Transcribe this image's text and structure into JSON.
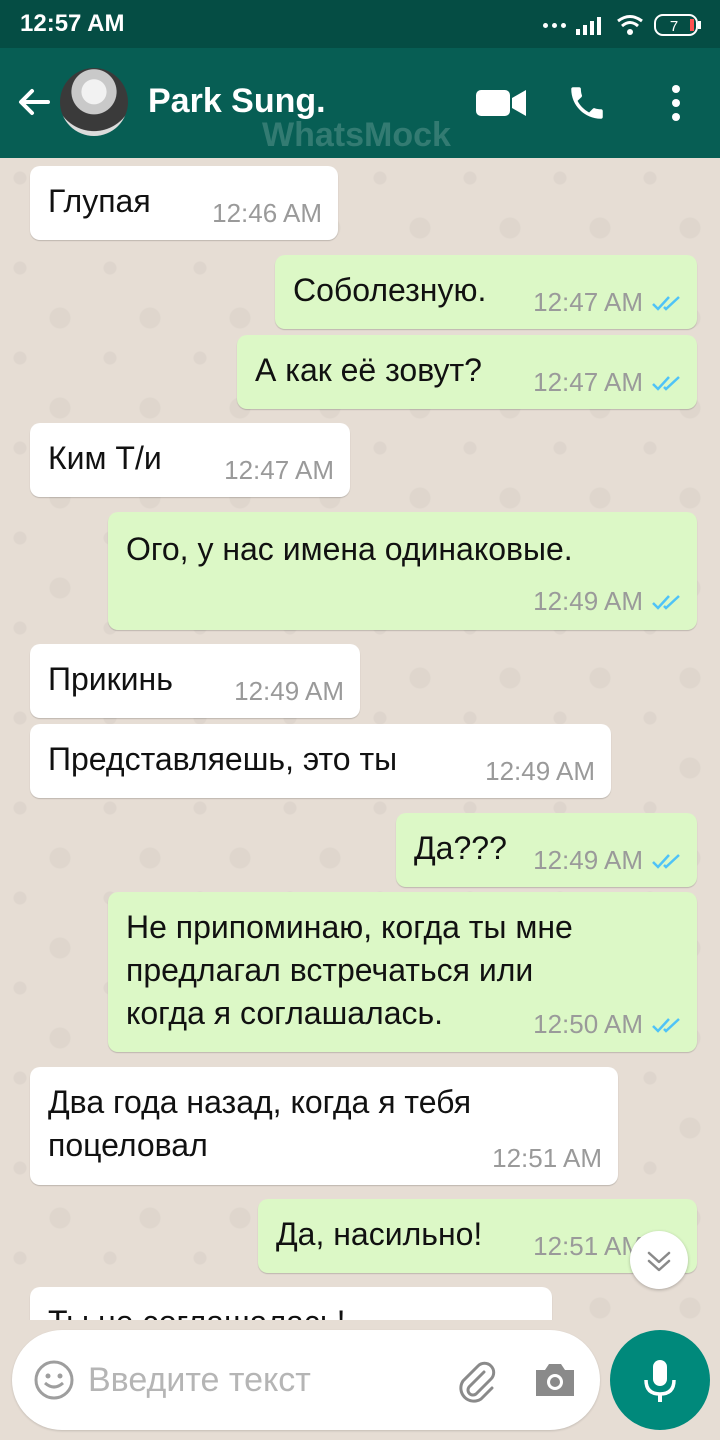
{
  "status_bar": {
    "time": "12:57 AM",
    "battery": "7"
  },
  "header": {
    "contact_name": "Park Sung.",
    "watermark": "WhatsMock"
  },
  "messages": [
    {
      "direction": "in",
      "lines": [
        "Глупая"
      ],
      "time": "12:46 AM"
    },
    {
      "direction": "out",
      "lines": [
        "Соболезную."
      ],
      "time": "12:47 AM",
      "status": "read"
    },
    {
      "direction": "out",
      "lines": [
        "А как её зовут?"
      ],
      "time": "12:47 AM",
      "status": "read"
    },
    {
      "direction": "in",
      "lines": [
        "Ким Т/и"
      ],
      "time": "12:47 AM"
    },
    {
      "direction": "out",
      "lines": [
        "Ого, у нас имена одинаковые."
      ],
      "time": "12:49 AM",
      "status": "read"
    },
    {
      "direction": "in",
      "lines": [
        "Прикинь"
      ],
      "time": "12:49 AM"
    },
    {
      "direction": "in",
      "lines": [
        "Представляешь, это ты"
      ],
      "time": "12:49 AM"
    },
    {
      "direction": "out",
      "lines": [
        "Да???"
      ],
      "time": "12:49 AM",
      "status": "read"
    },
    {
      "direction": "out",
      "lines": [
        "Не припоминаю, когда ты мне",
        "предлагал встречаться или",
        "когда я соглашалась."
      ],
      "time": "12:50 AM",
      "status": "read"
    },
    {
      "direction": "in",
      "lines": [
        "Два года назад, когда я тебя",
        "поцеловал"
      ],
      "time": "12:51 AM"
    },
    {
      "direction": "out",
      "lines": [
        "Да, насильно!"
      ],
      "time": "12:51 AM",
      "status": "read"
    },
    {
      "direction": "in",
      "lines": [
        "Ты не соглашалась!"
      ],
      "time": ""
    }
  ],
  "input": {
    "placeholder": "Введите текст"
  },
  "colors": {
    "header": "#075e54",
    "status_bar": "#054d44",
    "outgoing_bubble": "#dcf8c6",
    "incoming_bubble": "#ffffff",
    "read_ticks": "#4fc3f7",
    "mic_button": "#00897b"
  },
  "icons": {
    "back": "arrow-left-icon",
    "video": "video-camera-icon",
    "call": "phone-icon",
    "menu": "more-vert-icon",
    "emoji": "smiley-icon",
    "attach": "paperclip-icon",
    "camera": "camera-icon",
    "mic": "microphone-icon",
    "scroll": "double-chevron-down-icon",
    "read": "double-check-icon"
  }
}
